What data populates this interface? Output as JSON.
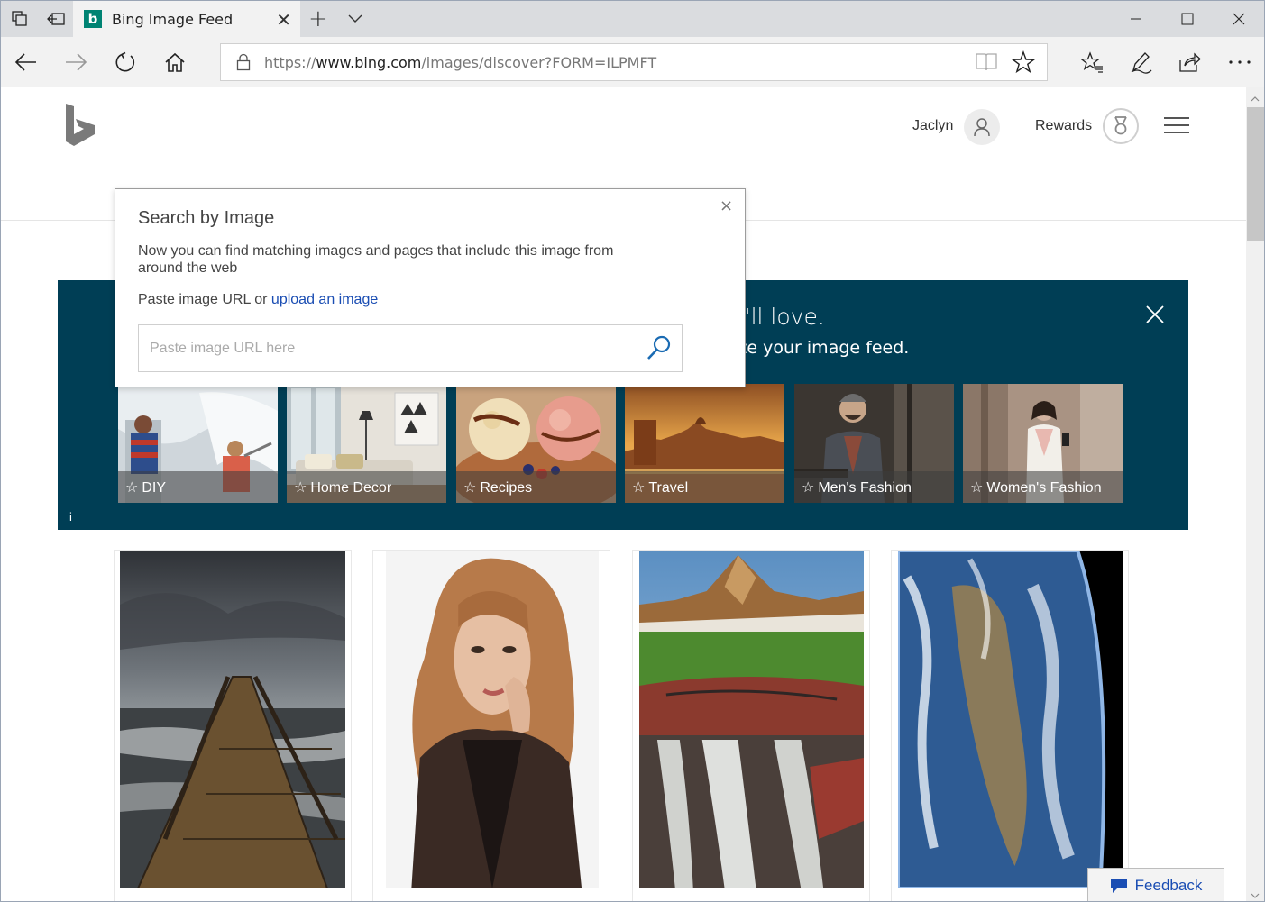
{
  "browser": {
    "tab_title": "Bing Image Feed",
    "tab_close": "✕",
    "new_tab": "+",
    "url_prefix": "https://",
    "url_host": "www.bing.com",
    "url_path": "/images/discover?FORM=ILPMFT"
  },
  "header": {
    "user_name": "Jaclyn",
    "rewards_label": "Rewards"
  },
  "popup": {
    "title": "Search by Image",
    "description": "Now you can find matching images and pages that include this image from around the web",
    "paste_text": "Paste image URL or",
    "upload_link": "upload an image",
    "input_placeholder": "Paste image URL here",
    "close": "×"
  },
  "banner": {
    "title": "Discover and save ideas you'll love.",
    "subtitle": "Follow interests that you like and we'll customize your image feed.",
    "info": "i",
    "topics": [
      {
        "label": "DIY"
      },
      {
        "label": "Home Decor"
      },
      {
        "label": "Recipes"
      },
      {
        "label": "Travel"
      },
      {
        "label": "Men's Fashion"
      },
      {
        "label": "Women's Fashion"
      }
    ]
  },
  "feed": {
    "cards": [
      {
        "subject": "pier under stormy sky"
      },
      {
        "subject": "portrait of woman"
      },
      {
        "subject": "mountain waterfall"
      },
      {
        "subject": "earth from space"
      }
    ]
  },
  "feedback": {
    "label": "Feedback"
  },
  "colors": {
    "banner_bg": "#003e55",
    "link_blue": "#1a4db3",
    "bing_teal": "#008373"
  }
}
